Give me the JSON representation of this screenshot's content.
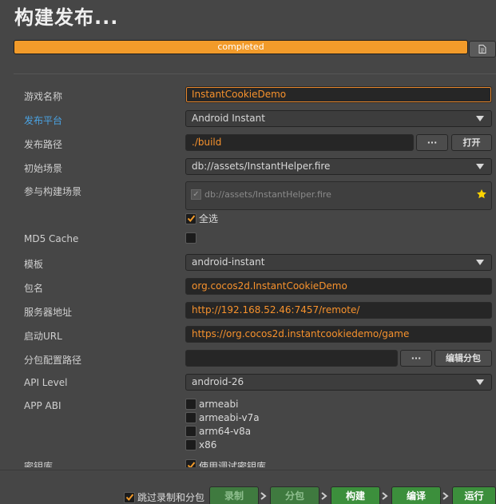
{
  "header": {
    "title": "构建发布..."
  },
  "progress": {
    "label": "completed",
    "value": 1.0
  },
  "rows": {
    "game_name": {
      "label": "游戏名称",
      "value": "InstantCookieDemo"
    },
    "platform": {
      "label": "发布平台",
      "value": "Android Instant"
    },
    "build_path": {
      "label": "发布路径",
      "value": "./build",
      "browse": "···",
      "open": "打开"
    },
    "start_scene": {
      "label": "初始场景",
      "value": "db://assets/InstantHelper.fire"
    },
    "scenes": {
      "label": "参与构建场景",
      "items": [
        "db://assets/InstantHelper.fire"
      ],
      "select_all": "全选"
    },
    "md5": {
      "label": "MD5 Cache"
    },
    "template": {
      "label": "模板",
      "value": "android-instant"
    },
    "package": {
      "label": "包名",
      "value": "org.cocos2d.InstantCookieDemo"
    },
    "server": {
      "label": "服务器地址",
      "value": "http://192.168.52.46:7457/remote/"
    },
    "start_url": {
      "label": "启动URL",
      "value": "https://org.cocos2d.instantcookiedemo/game"
    },
    "subpack": {
      "label": "分包配置路径",
      "value": "",
      "browse": "···",
      "edit": "编辑分包"
    },
    "api_level": {
      "label": "API Level",
      "value": "android-26"
    },
    "app_abi": {
      "label": "APP ABI",
      "options": [
        "armeabi",
        "armeabi-v7a",
        "arm64-v8a",
        "x86"
      ]
    },
    "cutoff": {
      "label": "密钥库",
      "checkbox_label": "使用调试密钥库"
    }
  },
  "footer": {
    "skip_label": "跳过录制和分包",
    "actions": [
      "录制",
      "分包",
      "构建",
      "编译",
      "运行"
    ]
  },
  "colors": {
    "accent": "#f29b2a",
    "highlight_label": "#4aa3e3",
    "button_green": "#3c8f3c"
  }
}
